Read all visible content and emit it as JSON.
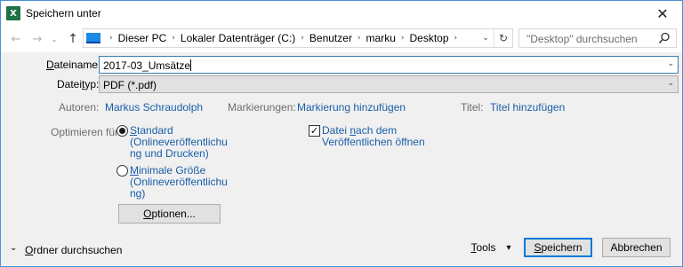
{
  "window": {
    "title": "Speichern unter",
    "app_icon_letter": "X",
    "close_glyph": "✕"
  },
  "nav": {
    "back_glyph": "←",
    "forward_glyph": "→",
    "recent_glyph": "⌄",
    "up_glyph": "↑",
    "breadcrumbs": [
      "Dieser PC",
      "Lokaler Datenträger (C:)",
      "Benutzer",
      "marku",
      "Desktop"
    ],
    "breadcrumb_sep": "›",
    "address_drop_glyph": "⌄",
    "refresh_glyph": "↻",
    "search_placeholder": "\"Desktop\" durchsuchen"
  },
  "form": {
    "filename_label_u": "D",
    "filename_label_rest": "ateiname:",
    "filename_value": "2017-03_Umsätze",
    "filetype_label_pre": "Datei",
    "filetype_label_u": "t",
    "filetype_label_rest": "yp:",
    "filetype_value": "PDF (*.pdf)",
    "dropdown_glyph": "⌄",
    "authors_label": "Autoren:",
    "authors_value": "Markus Schraudolph",
    "tags_label": "Markierungen:",
    "tags_value": "Markierung hinzufügen",
    "title_label": "Titel:",
    "title_value": "Titel hinzufügen",
    "optimize_label": "Optimieren für:",
    "opt_standard_u": "S",
    "opt_standard_rest": "tandard",
    "opt_standard_line2": "(Onlineveröffentlichu",
    "opt_standard_line3": "ng und Drucken)",
    "opt_minimal_u": "M",
    "opt_minimal_rest": "inimale Größe",
    "opt_minimal_line2": "(Onlineveröffentlichu",
    "opt_minimal_line3": "ng)",
    "options_button_u": "O",
    "options_button_rest": "ptionen...",
    "open_after_pre": "Datei ",
    "open_after_u": "n",
    "open_after_rest": "ach dem",
    "open_after_line2": "Veröffentlichen öffnen",
    "checkbox_glyph": "✓"
  },
  "footer": {
    "browse_glyph": "⌄",
    "browse_u": "O",
    "browse_rest": "rdner durchsuchen",
    "tools_u": "T",
    "tools_rest": "ools",
    "tools_drop": "▾",
    "save_u": "S",
    "save_rest": "peichern",
    "cancel": "Abbrechen"
  }
}
